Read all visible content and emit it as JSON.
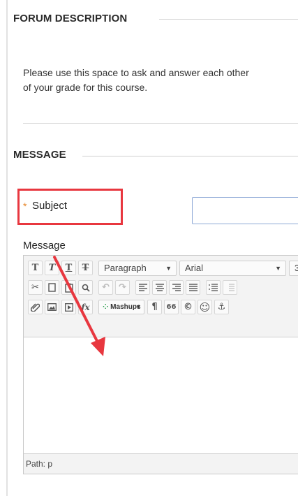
{
  "forum_description": {
    "title": "FORUM DESCRIPTION",
    "text_line1": "Please use this space to ask and answer each other",
    "text_line2": "of your grade for this course."
  },
  "message_section": {
    "title": "MESSAGE",
    "subject_required_marker": "*",
    "subject_label": "Subject",
    "subject_value": "",
    "message_label": "Message"
  },
  "editor": {
    "row1": {
      "bold": "T",
      "italic": "T",
      "underline": "T",
      "strikethrough": "T",
      "format_select": "Paragraph",
      "font_select": "Arial",
      "size_select": "3"
    },
    "row3": {
      "mashups_label": "Mashups",
      "paragraph_mark": "¶",
      "quote_mark": "66",
      "copyright": "©",
      "emoticon": "☺",
      "function_symbol": "fx"
    },
    "path_label": "Path: p"
  },
  "colors": {
    "highlight_red": "#e8373f",
    "required_orange": "#e6862a",
    "input_border": "#8ea9d6"
  }
}
